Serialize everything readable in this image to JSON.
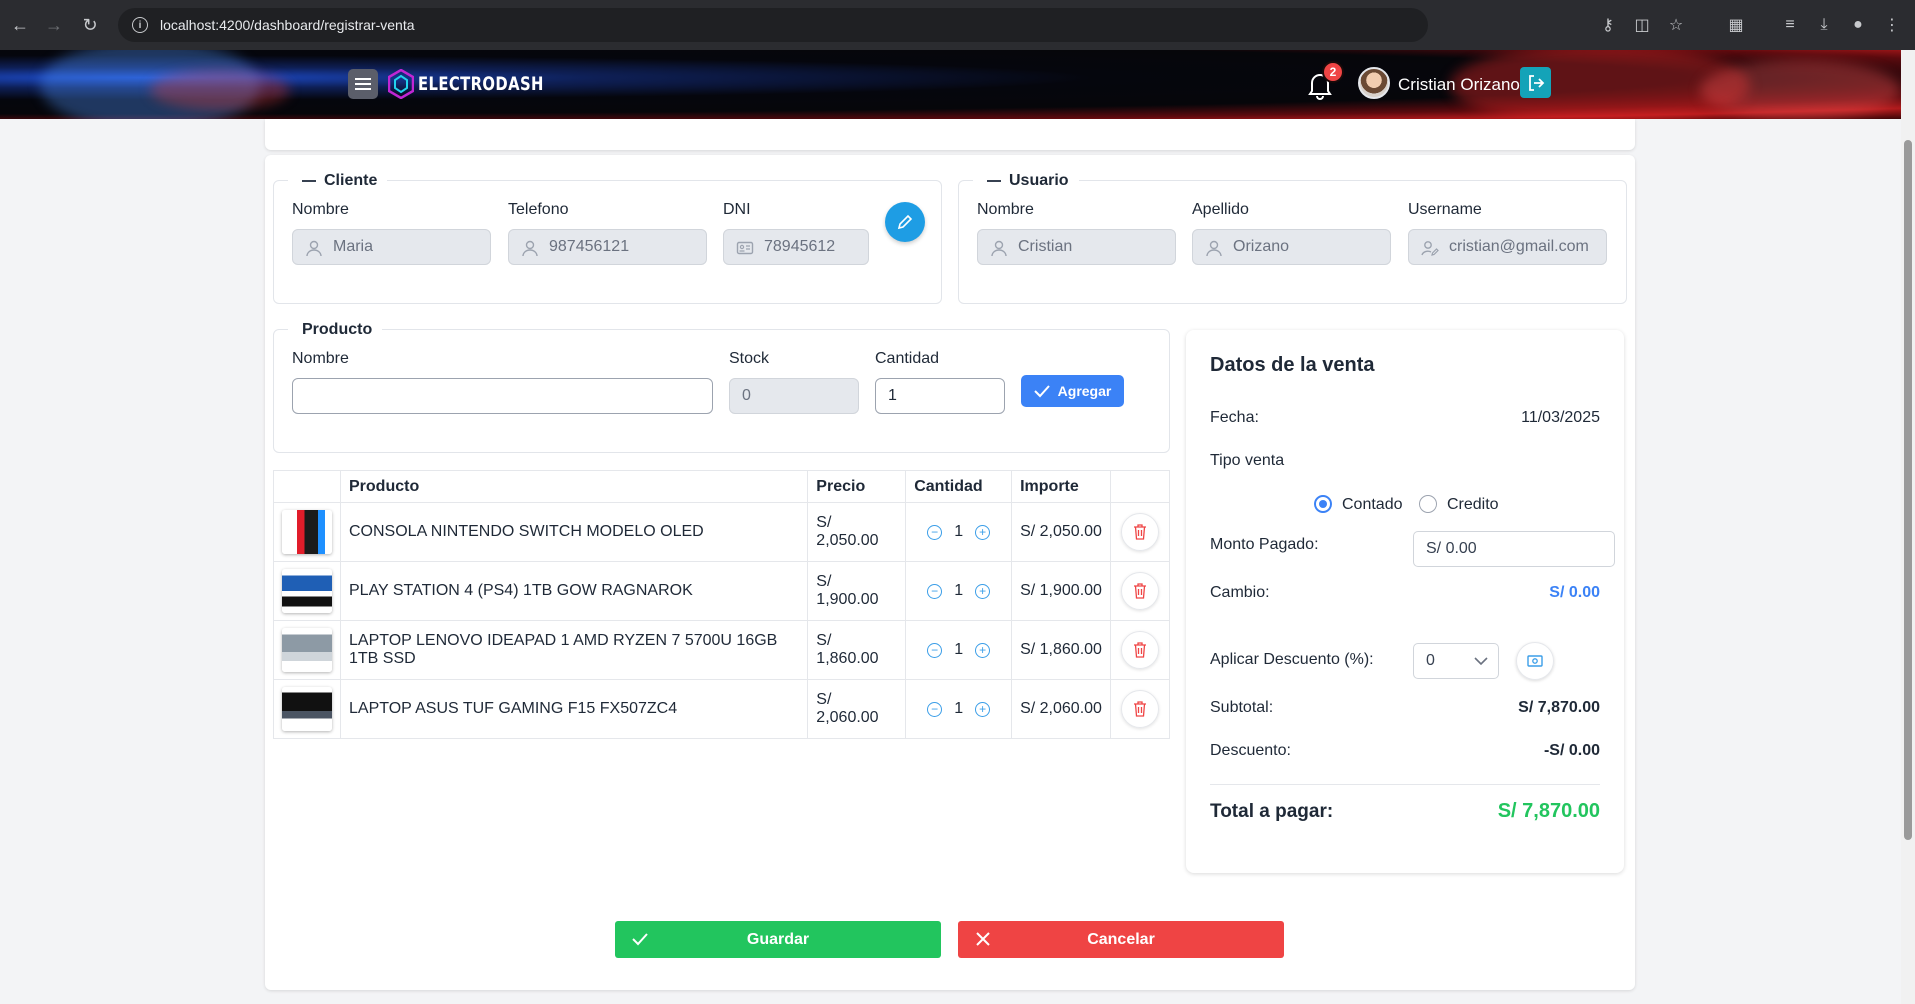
{
  "browser": {
    "url": "localhost:4200/dashboard/registrar-venta"
  },
  "header": {
    "brand": "ELECTRODASH",
    "notification_count": "2",
    "user_name": "Cristian Orizano"
  },
  "cliente": {
    "legend": "Cliente",
    "nombre_label": "Nombre",
    "nombre_value": "Maria",
    "telefono_label": "Telefono",
    "telefono_value": "987456121",
    "dni_label": "DNI",
    "dni_value": "78945612"
  },
  "usuario": {
    "legend": "Usuario",
    "nombre_label": "Nombre",
    "nombre_value": "Cristian",
    "apellido_label": "Apellido",
    "apellido_value": "Orizano",
    "username_label": "Username",
    "username_value": "cristian@gmail.com"
  },
  "producto": {
    "legend": "Producto",
    "nombre_label": "Nombre",
    "nombre_value": "",
    "stock_label": "Stock",
    "stock_value": "0",
    "cantidad_label": "Cantidad",
    "cantidad_value": "1",
    "agregar_label": "Agregar"
  },
  "table": {
    "headers": [
      "",
      "Producto",
      "Precio",
      "Cantidad",
      "Importe",
      ""
    ],
    "rows": [
      {
        "producto": "CONSOLA NINTENDO SWITCH MODELO OLED",
        "precio": "S/ 2,050.00",
        "cantidad": "1",
        "importe": "S/ 2,050.00"
      },
      {
        "producto": "PLAY STATION 4 (PS4) 1TB GOW RAGNAROK",
        "precio": "S/ 1,900.00",
        "cantidad": "1",
        "importe": "S/ 1,900.00"
      },
      {
        "producto": "LAPTOP LENOVO IDEAPAD 1 AMD RYZEN 7 5700U 16GB 1TB SSD",
        "precio": "S/ 1,860.00",
        "cantidad": "1",
        "importe": "S/ 1,860.00"
      },
      {
        "producto": "LAPTOP ASUS TUF GAMING F15 FX507ZC4",
        "precio": "S/ 2,060.00",
        "cantidad": "1",
        "importe": "S/ 2,060.00"
      }
    ]
  },
  "venta": {
    "title": "Datos de la venta",
    "fecha_label": "Fecha:",
    "fecha_value": "11/03/2025",
    "tipo_label": "Tipo venta",
    "contado_label": "Contado",
    "credito_label": "Credito",
    "selected_tipo": "Contado",
    "monto_label": "Monto Pagado:",
    "monto_value": "S/ 0.00",
    "cambio_label": "Cambio:",
    "cambio_value": "S/ 0.00",
    "descuento_pct_label": "Aplicar Descuento (%):",
    "descuento_pct_value": "0",
    "subtotal_label": "Subtotal:",
    "subtotal_value": "S/ 7,870.00",
    "descuento_label": "Descuento:",
    "descuento_value": "-S/ 0.00",
    "total_label": "Total a pagar:",
    "total_value": "S/ 7,870.00"
  },
  "actions": {
    "guardar": "Guardar",
    "cancelar": "Cancelar"
  },
  "colors": {
    "primary": "#3b82f6",
    "success": "#22c55e",
    "danger": "#ef4444",
    "edit": "#1e9de4",
    "logout": "#14a3b8"
  }
}
